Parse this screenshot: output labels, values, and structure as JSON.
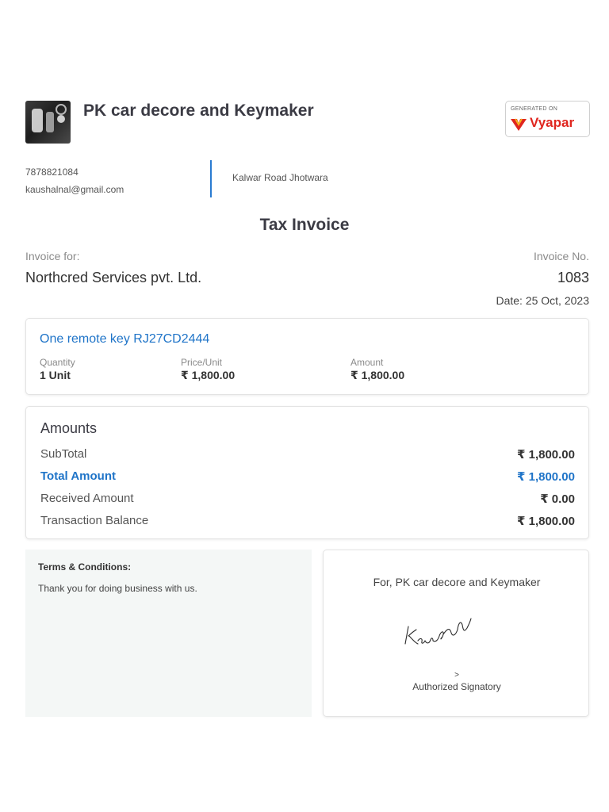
{
  "business": {
    "name": "PK car decore and Keymaker",
    "phone": "7878821084",
    "email": "kaushalnal@gmail.com",
    "address": "Kalwar Road Jhotwara"
  },
  "badge": {
    "generated_on": "GENERATED ON",
    "brand": "Vyapar",
    "brand_color": "#e0261f"
  },
  "document": {
    "title": "Tax Invoice"
  },
  "invoice": {
    "for_label": "Invoice for:",
    "customer": "Northcred Services pvt. Ltd.",
    "number_label": "Invoice No.",
    "number": "1083",
    "date": "Date: 25 Oct, 2023"
  },
  "item": {
    "name": "One remote key RJ27CD2444",
    "quantity_label": "Quantity",
    "quantity": "1 Unit",
    "price_label": "Price/Unit",
    "price": "₹ 1,800.00",
    "amount_label": "Amount",
    "amount": "₹ 1,800.00"
  },
  "amounts": {
    "title": "Amounts",
    "rows": [
      {
        "label": "SubTotal",
        "value": "₹ 1,800.00"
      },
      {
        "label": "Total Amount",
        "value": "₹ 1,800.00"
      },
      {
        "label": "Received Amount",
        "value": "₹ 0.00"
      },
      {
        "label": "Transaction Balance",
        "value": "₹ 1,800.00"
      }
    ]
  },
  "terms": {
    "title": "Terms & Conditions:",
    "text": "Thank you for doing business with us."
  },
  "signature": {
    "for_line": "For, PK car decore and Keymaker",
    "signed_name": "Kaushal",
    "mark": ">",
    "label": "Authorized Signatory"
  },
  "colors": {
    "accent_blue": "#1f74c8",
    "divider_blue": "#2a7bd1",
    "terms_bg": "#f4f7f6"
  }
}
